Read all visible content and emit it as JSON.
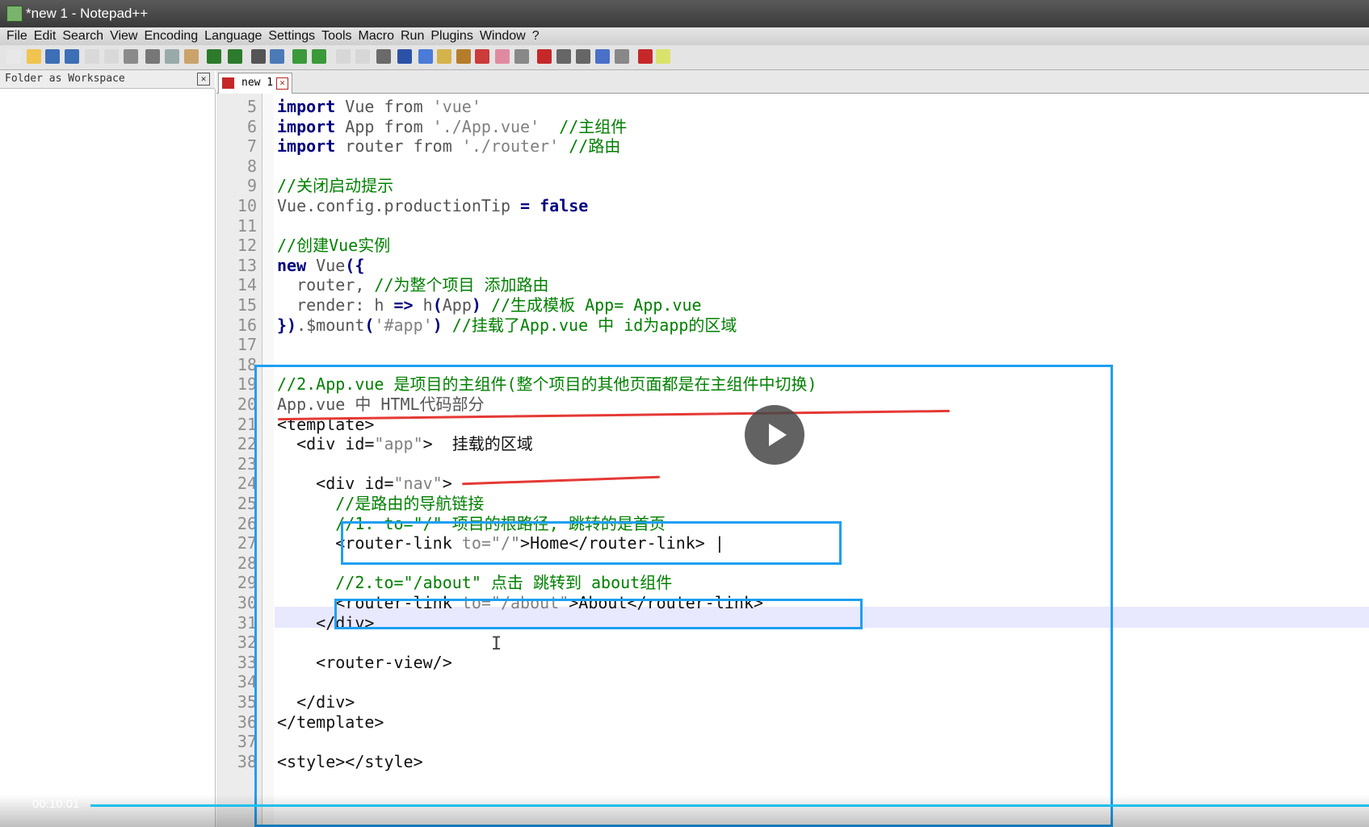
{
  "window": {
    "title": "*new 1 - Notepad++"
  },
  "menu": [
    "File",
    "Edit",
    "Search",
    "View",
    "Encoding",
    "Language",
    "Settings",
    "Tools",
    "Macro",
    "Run",
    "Plugins",
    "Window",
    "?"
  ],
  "toolbar_icons": [
    "new-file-icon",
    "open-file-icon",
    "save-icon",
    "save-all-icon",
    "close-icon",
    "close-all-icon",
    "print-icon",
    "cut-icon",
    "copy-icon",
    "paste-icon",
    "undo-icon",
    "redo-icon",
    "find-icon",
    "replace-icon",
    "zoom-in-icon",
    "zoom-out-icon",
    "sync-v-icon",
    "sync-h-icon",
    "wrap-icon",
    "show-all-icon",
    "indent-guide-icon",
    "udl-icon",
    "doc-map-icon",
    "function-list-icon",
    "folder-workspace-icon",
    "monitor-icon",
    "record-icon",
    "stop-icon",
    "play-icon",
    "run-multi-icon",
    "save-macro-icon",
    "spellcheck-icon",
    "extra-icon"
  ],
  "panel": {
    "title": "Folder as Workspace",
    "close": "✕"
  },
  "tab": {
    "label": "new 1",
    "close": "✕"
  },
  "lines": [
    {
      "n": "5",
      "segs": [
        {
          "t": "import",
          "c": "kw"
        },
        {
          "t": " Vue ",
          "c": ""
        },
        {
          "t": "from",
          "c": ""
        },
        {
          "t": " 'vue'",
          "c": "str"
        }
      ]
    },
    {
      "n": "6",
      "segs": [
        {
          "t": "import",
          "c": "kw"
        },
        {
          "t": " App ",
          "c": ""
        },
        {
          "t": "from",
          "c": ""
        },
        {
          "t": " './App.vue'",
          "c": "str"
        },
        {
          "t": "  //主组件",
          "c": "cmt"
        }
      ]
    },
    {
      "n": "7",
      "segs": [
        {
          "t": "import",
          "c": "kw"
        },
        {
          "t": " router ",
          "c": ""
        },
        {
          "t": "from",
          "c": ""
        },
        {
          "t": " './router'",
          "c": "str"
        },
        {
          "t": " //路由",
          "c": "cmt"
        }
      ]
    },
    {
      "n": "8",
      "segs": []
    },
    {
      "n": "9",
      "segs": [
        {
          "t": "//关闭启动提示",
          "c": "cmt"
        }
      ]
    },
    {
      "n": "10",
      "segs": [
        {
          "t": "Vue.config.productionTip ",
          "c": ""
        },
        {
          "t": "=",
          "c": "kw"
        },
        {
          "t": " ",
          "c": ""
        },
        {
          "t": "false",
          "c": "kw"
        }
      ]
    },
    {
      "n": "11",
      "segs": []
    },
    {
      "n": "12",
      "segs": [
        {
          "t": "//创建Vue实例",
          "c": "cmt"
        }
      ]
    },
    {
      "n": "13",
      "segs": [
        {
          "t": "new",
          "c": "kw"
        },
        {
          "t": " Vue",
          "c": ""
        },
        {
          "t": "({",
          "c": "kw"
        }
      ]
    },
    {
      "n": "14",
      "segs": [
        {
          "t": "  router, ",
          "c": ""
        },
        {
          "t": "//为整个项目 添加路由",
          "c": "cmt"
        }
      ]
    },
    {
      "n": "15",
      "segs": [
        {
          "t": "  render: h ",
          "c": ""
        },
        {
          "t": "=>",
          "c": "kw"
        },
        {
          "t": " h",
          "c": ""
        },
        {
          "t": "(",
          "c": "kw"
        },
        {
          "t": "App",
          "c": ""
        },
        {
          "t": ")",
          "c": "kw"
        },
        {
          "t": " //生成模板 App= App.vue",
          "c": "cmt"
        }
      ]
    },
    {
      "n": "16",
      "segs": [
        {
          "t": "})",
          "c": "kw"
        },
        {
          "t": ".$mount",
          "c": ""
        },
        {
          "t": "(",
          "c": "kw"
        },
        {
          "t": "'#app'",
          "c": "str"
        },
        {
          "t": ")",
          "c": "kw"
        },
        {
          "t": " //挂载了App.vue 中 id为app的区域",
          "c": "cmt"
        }
      ]
    },
    {
      "n": "17",
      "segs": []
    },
    {
      "n": "18",
      "segs": []
    },
    {
      "n": "19",
      "segs": [
        {
          "t": "//2.App.vue 是项目的主组件(整个项目的其他页面都是在主组件中切换)",
          "c": "cmt"
        }
      ]
    },
    {
      "n": "20",
      "segs": [
        {
          "t": "App.vue 中 HTML代码部分",
          "c": ""
        }
      ]
    },
    {
      "n": "21",
      "segs": [
        {
          "t": "<template>",
          "c": "tag"
        }
      ]
    },
    {
      "n": "22",
      "segs": [
        {
          "t": "  <div id=",
          "c": "tag"
        },
        {
          "t": "\"app\"",
          "c": "str"
        },
        {
          "t": ">  挂载的区域",
          "c": "tag"
        }
      ]
    },
    {
      "n": "23",
      "segs": []
    },
    {
      "n": "24",
      "segs": [
        {
          "t": "    <div id=",
          "c": "tag"
        },
        {
          "t": "\"nav\"",
          "c": "str"
        },
        {
          "t": ">",
          "c": "tag"
        }
      ]
    },
    {
      "n": "25",
      "segs": [
        {
          "t": "      //是路由的导航链接",
          "c": "cmt"
        }
      ]
    },
    {
      "n": "26",
      "segs": [
        {
          "t": "      //1. to=\"/\" 项目的根路径, 跳转的是首页",
          "c": "cmt"
        }
      ]
    },
    {
      "n": "27",
      "segs": [
        {
          "t": "      <router-link ",
          "c": "tag"
        },
        {
          "t": "to=\"/\"",
          "c": "str"
        },
        {
          "t": ">Home</router-link> |",
          "c": "tag"
        }
      ]
    },
    {
      "n": "28",
      "segs": []
    },
    {
      "n": "29",
      "segs": [
        {
          "t": "      //2.to=\"/about\" 点击 跳转到 about组件",
          "c": "cmt"
        }
      ]
    },
    {
      "n": "30",
      "segs": [
        {
          "t": "      <router-link ",
          "c": "tag"
        },
        {
          "t": "to=\"/about\"",
          "c": "str"
        },
        {
          "t": ">About</router-link>",
          "c": "tag"
        }
      ]
    },
    {
      "n": "31",
      "segs": [
        {
          "t": "    </div>",
          "c": "tag"
        }
      ]
    },
    {
      "n": "32",
      "segs": []
    },
    {
      "n": "33",
      "segs": [
        {
          "t": "    <router-view/>",
          "c": "tag"
        }
      ]
    },
    {
      "n": "34",
      "segs": []
    },
    {
      "n": "35",
      "segs": [
        {
          "t": "  </div>",
          "c": "tag"
        }
      ]
    },
    {
      "n": "36",
      "segs": [
        {
          "t": "</template>",
          "c": "tag"
        }
      ]
    },
    {
      "n": "37",
      "segs": []
    },
    {
      "n": "38",
      "segs": [
        {
          "t": "<style></style>",
          "c": "tag"
        }
      ]
    }
  ],
  "video": {
    "timestamp": "00:10:01"
  },
  "colors": {
    "keyword": "#000080",
    "comment": "#008000",
    "string": "#808080",
    "annotation_box": "#1e9ff2",
    "annotation_underline": "#e53935",
    "progress": "#1ec0ec"
  }
}
